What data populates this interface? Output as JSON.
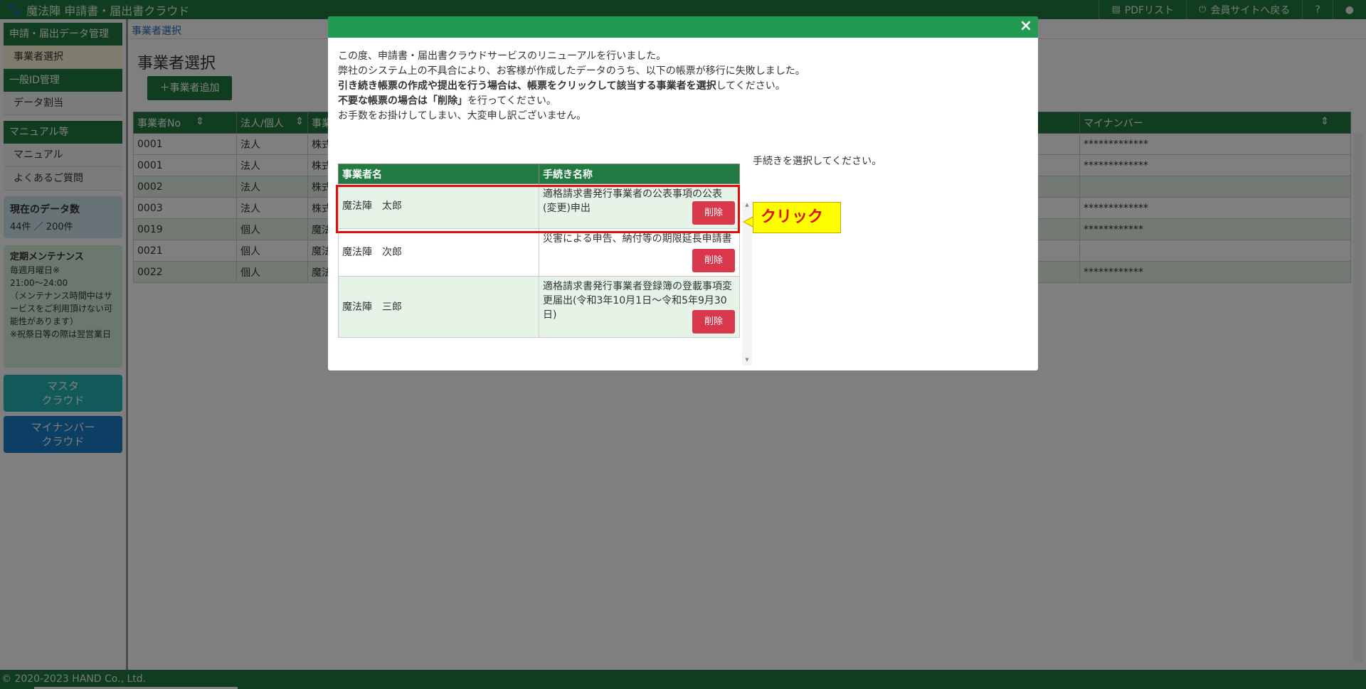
{
  "app": {
    "title": "魔法陣 申請書・届出書クラウド"
  },
  "topnav": {
    "pdf_list": "PDFリスト",
    "member_site": "会員サイトへ戻る",
    "help": "?",
    "user": "●"
  },
  "sidebar": {
    "section1": "申請・届出データ管理",
    "item_select": "事業者選択",
    "section2": "一般ID管理",
    "item_assign": "データ割当",
    "section3": "マニュアル等",
    "item_manual": "マニュアル",
    "item_faq": "よくあるご質問",
    "data_count_title": "現在のデータ数",
    "data_count_value": "44件 ／ 200件",
    "maint_title": "定期メンテナンス",
    "maint_lines": [
      "毎週月曜日※",
      "21:00～24:00",
      "（メンテナンス時間中はサービスをご利用頂けない可能性があります）",
      "※祝祭日等の際は翌営業日"
    ],
    "btn_master": "マスタ\nクラウド",
    "btn_mynumber": "マイナンバー\nクラウド"
  },
  "main": {
    "breadcrumb": "事業者選択",
    "title": "事業者選択",
    "add_button": "＋事業者追加",
    "columns": [
      "事業者No",
      "法人/個人",
      "事業",
      "マイナンバー"
    ],
    "rows": [
      [
        "0001",
        "法人",
        "株式",
        "*************"
      ],
      [
        "0001",
        "法人",
        "株式",
        "*************"
      ],
      [
        "0002",
        "法人",
        "株式",
        ""
      ],
      [
        "0003",
        "法人",
        "株式",
        "*************"
      ],
      [
        "0019",
        "個人",
        "魔法",
        "************"
      ],
      [
        "0021",
        "個人",
        "魔法",
        ""
      ],
      [
        "0022",
        "個人",
        "魔法",
        "************"
      ]
    ]
  },
  "footer": {
    "copyright": "© 2020-2023 HAND Co., Ltd."
  },
  "modal": {
    "close": "×",
    "line1": "この度、申請書・届出書クラウドサービスのリニューアルを行いました。",
    "line2": "弊社のシステム上の不具合により、お客様が作成したデータのうち、以下の帳票が移行に失敗しました。",
    "line3_bold": "引き続き帳票の作成や提出を行う場合は、帳票をクリックして該当する事業者を選択",
    "line3_rest": "してください。",
    "line4_bold": "不要な帳票の場合は「削除」",
    "line4_rest": "を行ってください。",
    "line5": "お手数をお掛けしてしまい、大変申し訳ございません。",
    "col_name": "事業者名",
    "col_proc": "手続き名称",
    "select_prompt": "手続きを選択してください。",
    "delete_label": "削除",
    "rows": [
      {
        "name": "魔法陣　太郎",
        "proc": "適格請求書発行事業者の公表事項の公表(変更)申出"
      },
      {
        "name": "魔法陣　次郎",
        "proc": "災害による申告、納付等の期限延長申請書"
      },
      {
        "name": "魔法陣　三郎",
        "proc": "適格請求書発行事業者登録簿の登載事項変更届出(令和3年10月1日～令和5年9月30日)"
      }
    ]
  },
  "callout": {
    "text": "クリック"
  }
}
